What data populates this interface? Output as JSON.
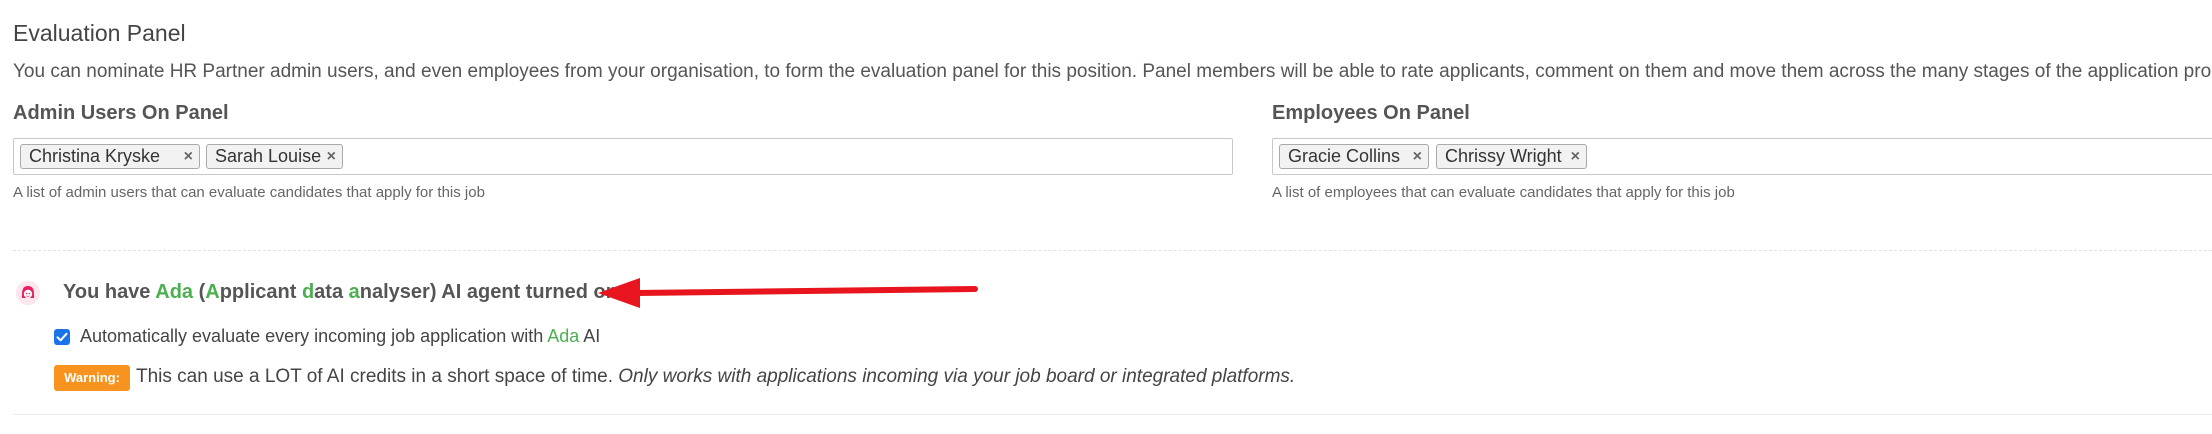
{
  "panel": {
    "title": "Evaluation Panel",
    "description": "You can nominate HR Partner admin users, and even employees from your organisation, to form the evaluation panel for this position. Panel members will be able to rate applicants, comment on them and move them across the many stages of the application process."
  },
  "admin_users": {
    "label": "Admin Users On Panel",
    "tags": [
      "Christina Kryske",
      "Sarah Louise"
    ],
    "help": "A list of admin users that can evaluate candidates that apply for this job"
  },
  "employees": {
    "label": "Employees On Panel",
    "tags": [
      "Gracie Collins",
      "Chrissy Wright"
    ],
    "help": "A list of employees that can evaluate candidates that apply for this job"
  },
  "tag_remove_glyph": "×",
  "ada": {
    "icon": "ada-agent-icon",
    "prefix": "You have ",
    "name": "Ada",
    "paren_open": " (",
    "A": "A",
    "pplicant": "pplicant ",
    "d": "d",
    "ata": "ata ",
    "a": "a",
    "nalyser": "nalyser",
    "suffix": ") AI agent turned on."
  },
  "auto_eval": {
    "checked": true,
    "label_prefix": "Automatically evaluate every incoming job application with ",
    "label_ada": "Ada",
    "label_suffix": " AI"
  },
  "warning": {
    "badge": "Warning:",
    "text": "This can use a LOT of AI credits in a short space of time. ",
    "text_italic": "Only works with applications incoming via your job board or integrated platforms."
  },
  "colors": {
    "accent_green": "#4caf50",
    "warning_orange": "#f7931e",
    "arrow_red": "#e8141e",
    "checkbox_blue": "#1a73e8"
  }
}
